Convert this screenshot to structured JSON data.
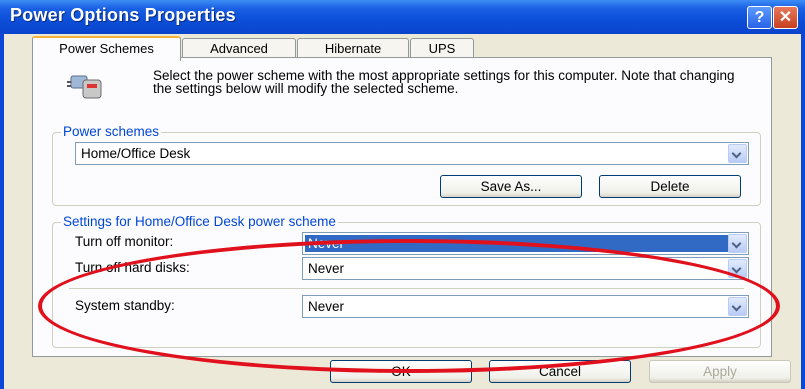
{
  "window": {
    "title": "Power Options Properties",
    "help_label": "?",
    "close_label": "✕"
  },
  "tabs": [
    {
      "label": "Power Schemes",
      "active": true
    },
    {
      "label": "Advanced",
      "active": false
    },
    {
      "label": "Hibernate",
      "active": false
    },
    {
      "label": "UPS",
      "active": false
    }
  ],
  "intro": {
    "icon": "power-schemes-icon",
    "text": "Select the power scheme with the most appropriate settings for this computer. Note that changing the settings below will modify the selected scheme."
  },
  "schemes_group": {
    "title": "Power schemes",
    "selected": "Home/Office Desk",
    "save_as_label": "Save As...",
    "delete_label": "Delete"
  },
  "settings_group": {
    "title": "Settings for Home/Office Desk power scheme",
    "rows": [
      {
        "label": "Turn off monitor:",
        "value": "Never"
      },
      {
        "label": "Turn off hard disks:",
        "value": "Never"
      },
      {
        "label": "System standby:",
        "value": "Never"
      }
    ]
  },
  "footer": {
    "ok_label": "OK",
    "cancel_label": "Cancel",
    "apply_label": "Apply"
  },
  "annotation_color": "#e0101c"
}
